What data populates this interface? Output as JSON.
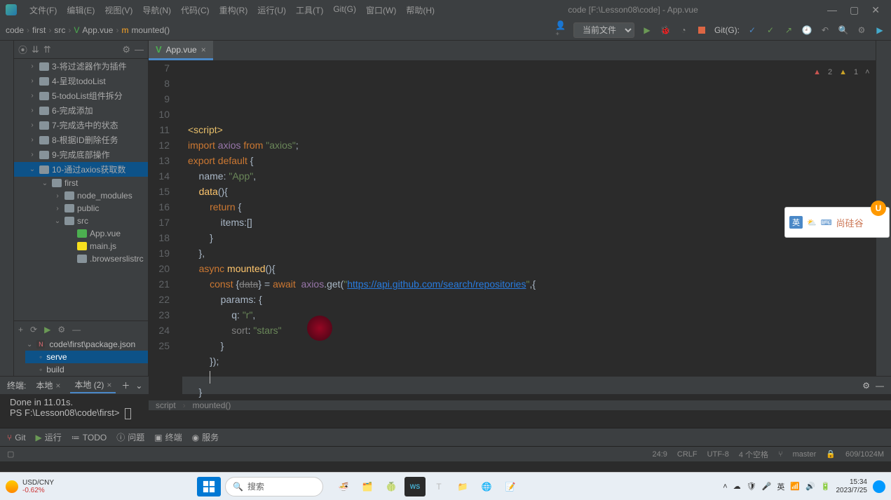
{
  "window": {
    "title": "code [F:\\Lesson08\\code] - App.vue"
  },
  "menu": [
    "文件(F)",
    "编辑(E)",
    "视图(V)",
    "导航(N)",
    "代码(C)",
    "重构(R)",
    "运行(U)",
    "工具(T)",
    "Git(G)",
    "窗口(W)",
    "帮助(H)"
  ],
  "crumbs": [
    "code",
    "first",
    "src",
    "App.vue",
    "mounted()"
  ],
  "runConfig": {
    "label": "当前文件",
    "git": "Git(G):"
  },
  "tab": {
    "label": "App.vue"
  },
  "inspection": {
    "errors": "2",
    "warnings": "1"
  },
  "tree": {
    "items": [
      {
        "label": "3-将过滤器作为插件",
        "indent": 0,
        "expand": "›"
      },
      {
        "label": "4-呈现todoList",
        "indent": 0,
        "expand": "›"
      },
      {
        "label": "5-todoList组件拆分",
        "indent": 0,
        "expand": "›"
      },
      {
        "label": "6-完成添加",
        "indent": 0,
        "expand": "›"
      },
      {
        "label": "7-完成选中的状态",
        "indent": 0,
        "expand": "›"
      },
      {
        "label": "8-根据ID删除任务",
        "indent": 0,
        "expand": "›"
      },
      {
        "label": "9-完成底部操作",
        "indent": 0,
        "expand": "›"
      },
      {
        "label": "10-通过axios获取数",
        "indent": 0,
        "expand": "⌄",
        "selected": true
      },
      {
        "label": "first",
        "indent": 1,
        "expand": "⌄"
      },
      {
        "label": "node_modules",
        "indent": 2,
        "expand": "›"
      },
      {
        "label": "public",
        "indent": 2,
        "expand": "›"
      },
      {
        "label": "src",
        "indent": 2,
        "expand": "⌄"
      },
      {
        "label": "App.vue",
        "indent": 3,
        "icon": "vue"
      },
      {
        "label": "main.js",
        "indent": 3,
        "icon": "js"
      },
      {
        "label": ".browserslistrc",
        "indent": 3
      }
    ]
  },
  "npm": {
    "title": "code\\first\\package.json",
    "scripts": [
      {
        "label": "serve",
        "selected": true
      },
      {
        "label": "build",
        "selected": false
      }
    ]
  },
  "code": {
    "startLine": 7,
    "lines": [
      {
        "n": 7,
        "html": ""
      },
      {
        "n": 8,
        "html": "<span class='tag'>&lt;script&gt;</span>"
      },
      {
        "n": 9,
        "html": "<span class='kw'>import</span> <span class='id'>axios</span> <span class='kw'>from</span> <span class='str'>\"axios\"</span>;"
      },
      {
        "n": 10,
        "html": "<span class='kw'>export default</span> {"
      },
      {
        "n": 11,
        "html": "    name: <span class='str'>\"App\"</span>,"
      },
      {
        "n": 12,
        "html": "    <span class='fn'>data</span>(){"
      },
      {
        "n": 13,
        "html": "        <span class='kw'>return</span> {"
      },
      {
        "n": 14,
        "html": "            items:[]"
      },
      {
        "n": 15,
        "html": "        }"
      },
      {
        "n": 16,
        "html": "    },"
      },
      {
        "n": 17,
        "html": "    <span class='kw'>async</span> <span class='fn'>mounted</span>(){"
      },
      {
        "n": 18,
        "html": "        <span class='kw'>const</span> {<span class='prop strike'>data</span>} = <span class='kw'>await</span>  <span class='id'>axios</span>.get(<span class='str'>\"</span><span class='url'>https://api.github.com/search/repositories</span><span class='str'>\"</span>,{"
      },
      {
        "n": 19,
        "html": "            params: {"
      },
      {
        "n": 20,
        "html": "                q: <span class='str'>\"r\"</span>,"
      },
      {
        "n": 21,
        "html": "                <span class='prop'>sort</span>: <span class='str'>\"stars\"</span>"
      },
      {
        "n": 22,
        "html": "            }"
      },
      {
        "n": 23,
        "html": "        });"
      },
      {
        "n": 24,
        "html": "        <span class='text-cursor'></span>"
      },
      {
        "n": 25,
        "html": "    }"
      }
    ]
  },
  "breadcrumb2": {
    "a": "script",
    "b": "mounted()"
  },
  "terminal": {
    "label": "终端:",
    "tabs": [
      {
        "label": "本地",
        "active": false
      },
      {
        "label": "本地 (2)",
        "active": true
      }
    ],
    "lines": [
      "Done in 11.01s.",
      "PS F:\\Lesson08\\code\\first> "
    ]
  },
  "toolButtons": [
    "Git",
    "运行",
    "TODO",
    "问题",
    "终端",
    "服务"
  ],
  "status": {
    "pos": "24:9",
    "sep": "CRLF",
    "enc": "UTF-8",
    "indent": "4 个空格",
    "branch": "master",
    "mem": "609/1024M"
  },
  "ime": {
    "lang": "英",
    "text": "尚硅谷",
    "badge": "U"
  },
  "taskbar": {
    "weather": {
      "pair": "USD/CNY",
      "change": "-0.62%"
    },
    "search": "搜索",
    "clock": {
      "time": "15:34",
      "date": "2023/7/25"
    }
  }
}
